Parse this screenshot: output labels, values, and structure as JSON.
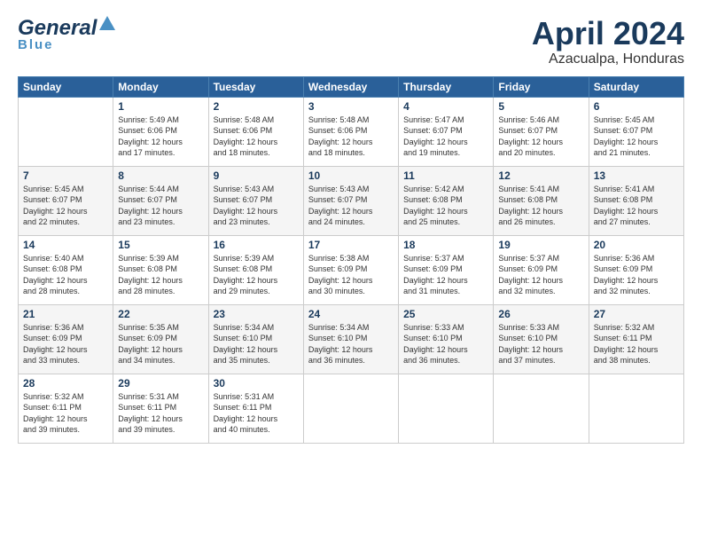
{
  "header": {
    "logo_general": "General",
    "logo_blue": "Blue",
    "title": "April 2024",
    "location": "Azacualpa, Honduras"
  },
  "days_of_week": [
    "Sunday",
    "Monday",
    "Tuesday",
    "Wednesday",
    "Thursday",
    "Friday",
    "Saturday"
  ],
  "weeks": [
    [
      {
        "day": "",
        "info": ""
      },
      {
        "day": "1",
        "info": "Sunrise: 5:49 AM\nSunset: 6:06 PM\nDaylight: 12 hours\nand 17 minutes."
      },
      {
        "day": "2",
        "info": "Sunrise: 5:48 AM\nSunset: 6:06 PM\nDaylight: 12 hours\nand 18 minutes."
      },
      {
        "day": "3",
        "info": "Sunrise: 5:48 AM\nSunset: 6:06 PM\nDaylight: 12 hours\nand 18 minutes."
      },
      {
        "day": "4",
        "info": "Sunrise: 5:47 AM\nSunset: 6:07 PM\nDaylight: 12 hours\nand 19 minutes."
      },
      {
        "day": "5",
        "info": "Sunrise: 5:46 AM\nSunset: 6:07 PM\nDaylight: 12 hours\nand 20 minutes."
      },
      {
        "day": "6",
        "info": "Sunrise: 5:45 AM\nSunset: 6:07 PM\nDaylight: 12 hours\nand 21 minutes."
      }
    ],
    [
      {
        "day": "7",
        "info": "Sunrise: 5:45 AM\nSunset: 6:07 PM\nDaylight: 12 hours\nand 22 minutes."
      },
      {
        "day": "8",
        "info": "Sunrise: 5:44 AM\nSunset: 6:07 PM\nDaylight: 12 hours\nand 23 minutes."
      },
      {
        "day": "9",
        "info": "Sunrise: 5:43 AM\nSunset: 6:07 PM\nDaylight: 12 hours\nand 23 minutes."
      },
      {
        "day": "10",
        "info": "Sunrise: 5:43 AM\nSunset: 6:07 PM\nDaylight: 12 hours\nand 24 minutes."
      },
      {
        "day": "11",
        "info": "Sunrise: 5:42 AM\nSunset: 6:08 PM\nDaylight: 12 hours\nand 25 minutes."
      },
      {
        "day": "12",
        "info": "Sunrise: 5:41 AM\nSunset: 6:08 PM\nDaylight: 12 hours\nand 26 minutes."
      },
      {
        "day": "13",
        "info": "Sunrise: 5:41 AM\nSunset: 6:08 PM\nDaylight: 12 hours\nand 27 minutes."
      }
    ],
    [
      {
        "day": "14",
        "info": "Sunrise: 5:40 AM\nSunset: 6:08 PM\nDaylight: 12 hours\nand 28 minutes."
      },
      {
        "day": "15",
        "info": "Sunrise: 5:39 AM\nSunset: 6:08 PM\nDaylight: 12 hours\nand 28 minutes."
      },
      {
        "day": "16",
        "info": "Sunrise: 5:39 AM\nSunset: 6:08 PM\nDaylight: 12 hours\nand 29 minutes."
      },
      {
        "day": "17",
        "info": "Sunrise: 5:38 AM\nSunset: 6:09 PM\nDaylight: 12 hours\nand 30 minutes."
      },
      {
        "day": "18",
        "info": "Sunrise: 5:37 AM\nSunset: 6:09 PM\nDaylight: 12 hours\nand 31 minutes."
      },
      {
        "day": "19",
        "info": "Sunrise: 5:37 AM\nSunset: 6:09 PM\nDaylight: 12 hours\nand 32 minutes."
      },
      {
        "day": "20",
        "info": "Sunrise: 5:36 AM\nSunset: 6:09 PM\nDaylight: 12 hours\nand 32 minutes."
      }
    ],
    [
      {
        "day": "21",
        "info": "Sunrise: 5:36 AM\nSunset: 6:09 PM\nDaylight: 12 hours\nand 33 minutes."
      },
      {
        "day": "22",
        "info": "Sunrise: 5:35 AM\nSunset: 6:09 PM\nDaylight: 12 hours\nand 34 minutes."
      },
      {
        "day": "23",
        "info": "Sunrise: 5:34 AM\nSunset: 6:10 PM\nDaylight: 12 hours\nand 35 minutes."
      },
      {
        "day": "24",
        "info": "Sunrise: 5:34 AM\nSunset: 6:10 PM\nDaylight: 12 hours\nand 36 minutes."
      },
      {
        "day": "25",
        "info": "Sunrise: 5:33 AM\nSunset: 6:10 PM\nDaylight: 12 hours\nand 36 minutes."
      },
      {
        "day": "26",
        "info": "Sunrise: 5:33 AM\nSunset: 6:10 PM\nDaylight: 12 hours\nand 37 minutes."
      },
      {
        "day": "27",
        "info": "Sunrise: 5:32 AM\nSunset: 6:11 PM\nDaylight: 12 hours\nand 38 minutes."
      }
    ],
    [
      {
        "day": "28",
        "info": "Sunrise: 5:32 AM\nSunset: 6:11 PM\nDaylight: 12 hours\nand 39 minutes."
      },
      {
        "day": "29",
        "info": "Sunrise: 5:31 AM\nSunset: 6:11 PM\nDaylight: 12 hours\nand 39 minutes."
      },
      {
        "day": "30",
        "info": "Sunrise: 5:31 AM\nSunset: 6:11 PM\nDaylight: 12 hours\nand 40 minutes."
      },
      {
        "day": "",
        "info": ""
      },
      {
        "day": "",
        "info": ""
      },
      {
        "day": "",
        "info": ""
      },
      {
        "day": "",
        "info": ""
      }
    ]
  ]
}
